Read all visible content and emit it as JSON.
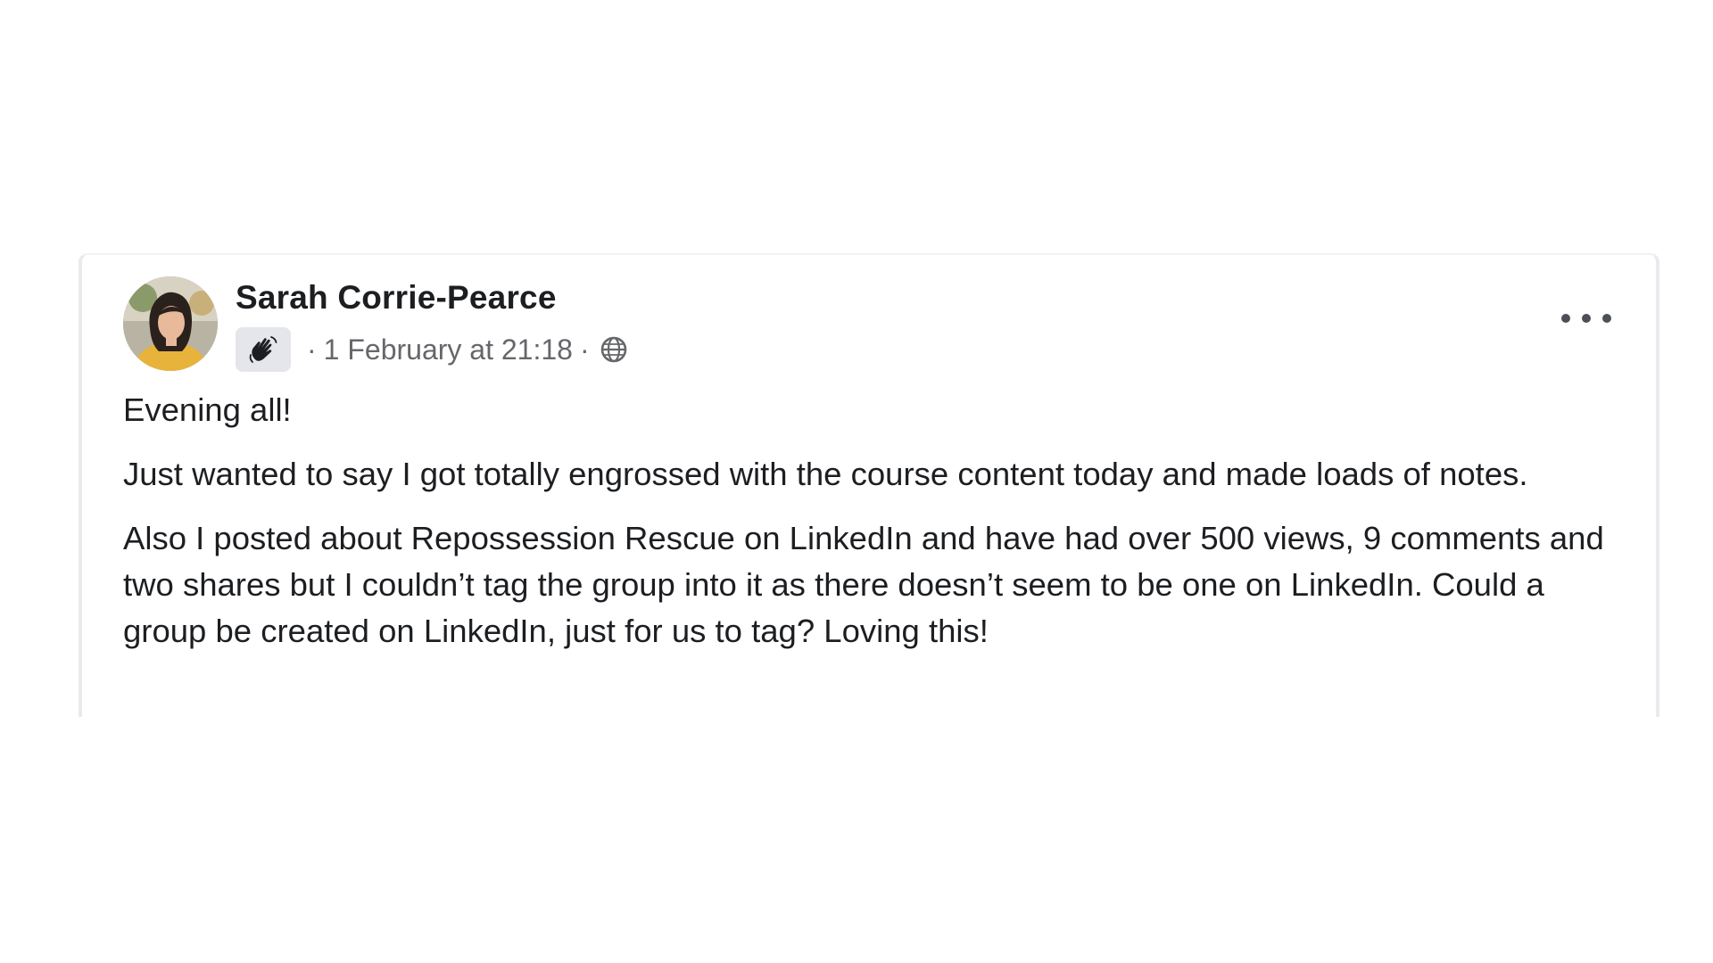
{
  "post": {
    "author_name": "Sarah Corrie-Pearce",
    "badge_icon": "waving-hand-icon",
    "timestamp": "1 February at 21:18",
    "separator": "·",
    "privacy_icon": "globe-icon",
    "more_icon": "more-options-icon",
    "paragraphs": [
      "Evening all!",
      "Just wanted to say I got totally engrossed with the course content today and made loads of notes.",
      "Also I posted about Repossession Rescue on LinkedIn and have had over 500 views, 9 comments and two shares but I couldn’t tag the group into it as there doesn’t seem to be one on LinkedIn. Could a group be created on LinkedIn, just for us to tag? Loving this!"
    ]
  },
  "colors": {
    "text_primary": "#1c1e21",
    "text_secondary": "#65676b",
    "badge_bg": "#e4e6eb",
    "card_border": "#e9eaed"
  }
}
